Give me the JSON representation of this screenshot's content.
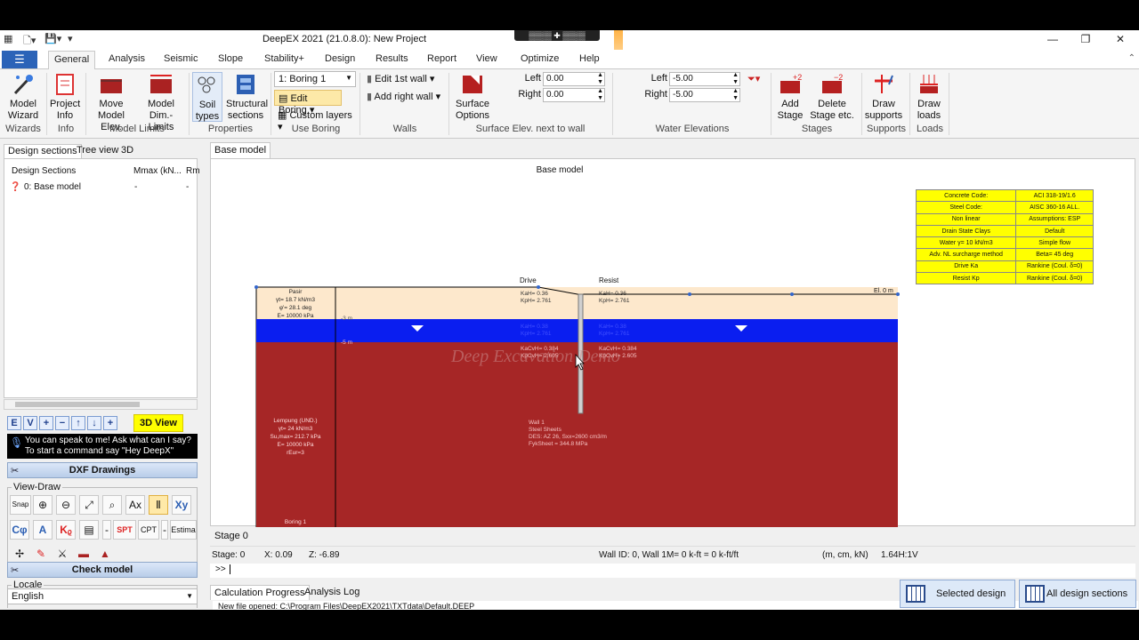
{
  "window": {
    "title": "DeepEX 2021  (21.0.8.0): New Project",
    "remote_indicator": "▒▒▒▒ ✚ ▒▒▒▒",
    "controls": [
      "—",
      "❐",
      "✕"
    ]
  },
  "menu_tabs": [
    "General",
    "Analysis",
    "Seismic",
    "Slope",
    "Stability+",
    "Design",
    "Results",
    "Report",
    "View",
    "Optimize",
    "Help"
  ],
  "ribbon": {
    "wizards": {
      "model_wizard": "Model\nWizard",
      "group": "Wizards"
    },
    "info": {
      "project_info": "Project\nInfo",
      "group": "Info"
    },
    "model_limits": {
      "move_model_elev": "Move\nModel Elev.",
      "model_dim_limits": "Model\nDim.-Limits",
      "group": "Model Limits"
    },
    "properties": {
      "soil_types": "Soil\ntypes",
      "structural_sections": "Structural\nsections",
      "group": "Properties"
    },
    "use_boring": {
      "boring_select": "1: Boring 1",
      "edit_boring": "Edit Boring",
      "custom_layers": "Custom layers",
      "group": "Use Boring"
    },
    "walls": {
      "edit_1st_wall": "Edit 1st wall",
      "add_right_wall": "Add right wall",
      "group": "Walls"
    },
    "surface": {
      "surface_options": "Surface\nOptions",
      "left_label": "Left",
      "left_value": "0.00",
      "right_label": "Right",
      "right_value": "0.00",
      "group": "Surface Elev. next to wall"
    },
    "water": {
      "left_label": "Left",
      "left_value": "-5.00",
      "right_label": "Right",
      "right_value": "-5.00",
      "group": "Water Elevations"
    },
    "stages": {
      "add_stage": "Add\nStage",
      "delete_stage": "Delete\nStage etc.",
      "group": "Stages"
    },
    "supports": {
      "draw_supports": "Draw\nsupports",
      "group": "Supports"
    },
    "loads": {
      "draw_loads": "Draw\nloads",
      "group": "Loads"
    }
  },
  "left_panel": {
    "tabs": [
      "Design sections",
      "Tree view",
      "3D"
    ],
    "grid_headers": [
      "Design Sections",
      "Mmax (kN...",
      "Rm"
    ],
    "rows": [
      {
        "name": "0: Base model",
        "mmax": "-",
        "rm": "-"
      }
    ],
    "nav_buttons": [
      "E",
      "V",
      "+",
      "−",
      "↑",
      "↓",
      "+"
    ],
    "view3d": "3D View",
    "voice_hint": "You can speak to me! Ask what can I say?\nTo start a command say \"Hey DeepX\"",
    "dxf_drawings": "DXF Drawings",
    "view_draw_legend": "View-Draw",
    "tools_row1": [
      "Snap",
      "⊕",
      "⊖",
      "⤢",
      "⌕",
      "Ax",
      "Ⅱ",
      "Xy"
    ],
    "tools_row2": [
      "Cφ",
      "A",
      "Kᵨ",
      "▤",
      "-",
      "SPT",
      "CPT",
      "-",
      "Estima"
    ],
    "tools_row3": [
      "✢",
      "✎",
      "⚔",
      "▬",
      "▲"
    ],
    "check_model": "Check model",
    "locale_legend": "Locale",
    "locale_value": "English"
  },
  "main": {
    "tab": "Base model",
    "canvas_title": "Base model",
    "watermark": "Deep Excavation Demo",
    "drive_label": "Drive",
    "resist_label": "Resist",
    "elevation_label": "El. 0 m",
    "boring_label": "Boring 1",
    "soil_pasir": [
      "Pasir",
      "γt= 18.7 kN/m3",
      "φ'= 28.1 deg",
      "E= 10000 kPa"
    ],
    "soil_lempung": [
      "Lempung (UND.)",
      "γt= 24 kN/m3",
      "Su,max= 212.7 kPa",
      "E= 10000 kPa",
      "rEur=3"
    ],
    "drive_k1": [
      "KaH= 0.36",
      "KpH= 2.761"
    ],
    "drive_k2": [
      "KaH= 0.38",
      "KpH= 2.761"
    ],
    "drive_k3": [
      "KaCvH= 0.384",
      "KpCvH= 2.605"
    ],
    "resist_k1": [
      "KaH= 0.36",
      "KpH= 2.761"
    ],
    "resist_k2": [
      "KaH= 0.38",
      "KpH= 2.761"
    ],
    "resist_k3": [
      "KaCvH= 0.384",
      "KpCvH= 2.605"
    ],
    "wall_info": [
      "Wall 1",
      "Steel Sheets",
      "DES: AZ 26, Sxx=2600 cm3/m",
      "FykSheet = 344.8 MPa"
    ],
    "depth_marks": [
      "-3 m",
      "-5 m"
    ],
    "properties_table": [
      [
        "Concrete Code:",
        "ACI 318-19/1.6"
      ],
      [
        "Steel Code:",
        "AISC 360-16 ALL."
      ],
      [
        "Non linear",
        "Assumptions: ESP"
      ],
      [
        "Drain State Clays",
        "Default"
      ],
      [
        "Water γ= 10 kN/m3",
        "Simple flow"
      ],
      [
        "Adv. NL surcharge method",
        "Beta= 45 deg"
      ],
      [
        "Drive Ka",
        "Rankine (Coul. δ=0)"
      ],
      [
        "Resist Kp",
        "Rankine (Coul. δ=0)"
      ]
    ],
    "colors": {
      "sand": "#fde8cc",
      "water": "#0a1ef0",
      "clay": "#a62626",
      "table": "#ffff00"
    },
    "stage_tab": "Stage 0",
    "status": {
      "stage": "Stage: 0",
      "x": "X: 0.09",
      "z": "Z: -6.89",
      "wall": "Wall ID: 0, Wall 1M= 0 k-ft = 0 k-ft/ft",
      "units": "(m, cm, kN)",
      "scale": "1.64H:1V"
    },
    "cmd_prompt": ">>",
    "bottom_tabs": [
      "Calculation Progress",
      "Analysis Log"
    ],
    "log_line": "New file opened: C:\\Program Files\\DeepEX2021\\TXTdata\\Default.DEEP",
    "selected_design": "Selected design",
    "all_design_sections": "All design sections"
  }
}
